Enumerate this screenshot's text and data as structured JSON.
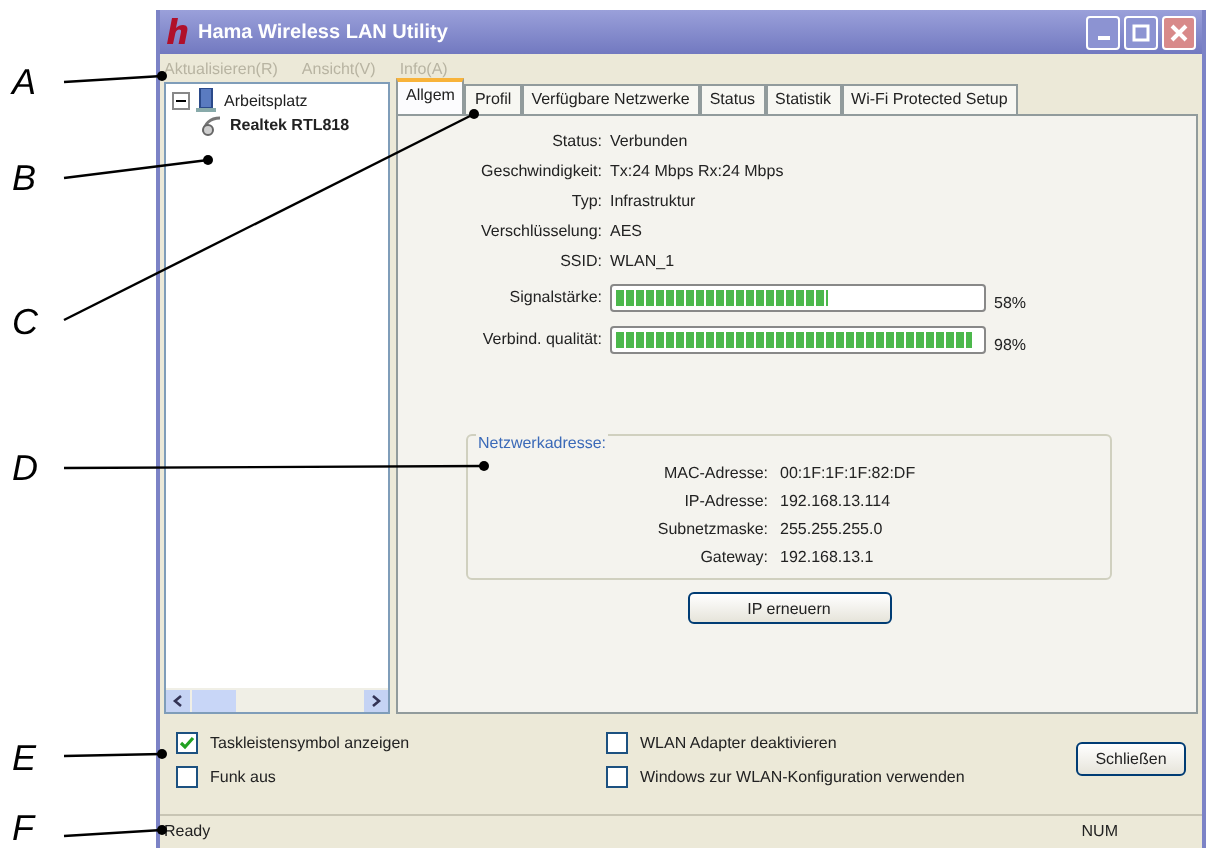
{
  "callouts": [
    "A",
    "B",
    "C",
    "D",
    "E",
    "F"
  ],
  "window": {
    "title": "Hama Wireless LAN Utility"
  },
  "menu": [
    {
      "label": "Aktualisieren(R)",
      "disabled": true
    },
    {
      "label": "Ansicht(V)",
      "disabled": true
    },
    {
      "label": "Info(A)",
      "disabled": true
    }
  ],
  "tree": [
    {
      "label": "Arbeitsplatz",
      "expanded": true,
      "children": [
        {
          "label": "Realtek RTL818"
        }
      ]
    }
  ],
  "tabs": [
    {
      "label": "Allgem",
      "selected": true
    },
    {
      "label": "Profil",
      "selected": false
    },
    {
      "label": "Verfügbare Netzwerke",
      "selected": false
    },
    {
      "label": "Status",
      "selected": false
    },
    {
      "label": "Statistik",
      "selected": false
    },
    {
      "label": "Wi-Fi Protected Setup",
      "selected": false
    }
  ],
  "info": [
    {
      "label": "Status:",
      "value": "Verbunden"
    },
    {
      "label": "Geschwindigkeit:",
      "value": "Tx:24 Mbps Rx:24 Mbps"
    },
    {
      "label": "Typ:",
      "value": "Infrastruktur"
    },
    {
      "label": "Verschlüsselung:",
      "value": "AES"
    },
    {
      "label": "SSID:",
      "value": "WLAN_1"
    }
  ],
  "meters": [
    {
      "label": "Signalstärke:",
      "level": 0.58,
      "reading": "58%"
    },
    {
      "label": "Verbind. qualität:",
      "level": 0.98,
      "reading": "98%"
    }
  ],
  "network": {
    "title": "Netzwerkadresse:",
    "rows": [
      {
        "label": "MAC-Adresse:",
        "value": "00:1F:1F:1F:82:DF"
      },
      {
        "label": "IP-Adresse:",
        "value": "192.168.13.114"
      },
      {
        "label": "Subnetzmaske:",
        "value": "255.255.255.0"
      },
      {
        "label": "Gateway:",
        "value": "192.168.13.1"
      }
    ]
  },
  "renew_button": "IP erneuern",
  "options": [
    {
      "label": "Taskleistensymbol anzeigen",
      "checked": true
    },
    {
      "label": "WLAN Adapter deaktivieren",
      "checked": false
    },
    {
      "label": "Funk aus",
      "checked": false
    },
    {
      "label": "Windows zur WLAN-Konfiguration verwenden",
      "checked": false
    }
  ],
  "close_button": "Schließen",
  "status_bar": {
    "text": "Ready",
    "indicator": "NUM"
  }
}
